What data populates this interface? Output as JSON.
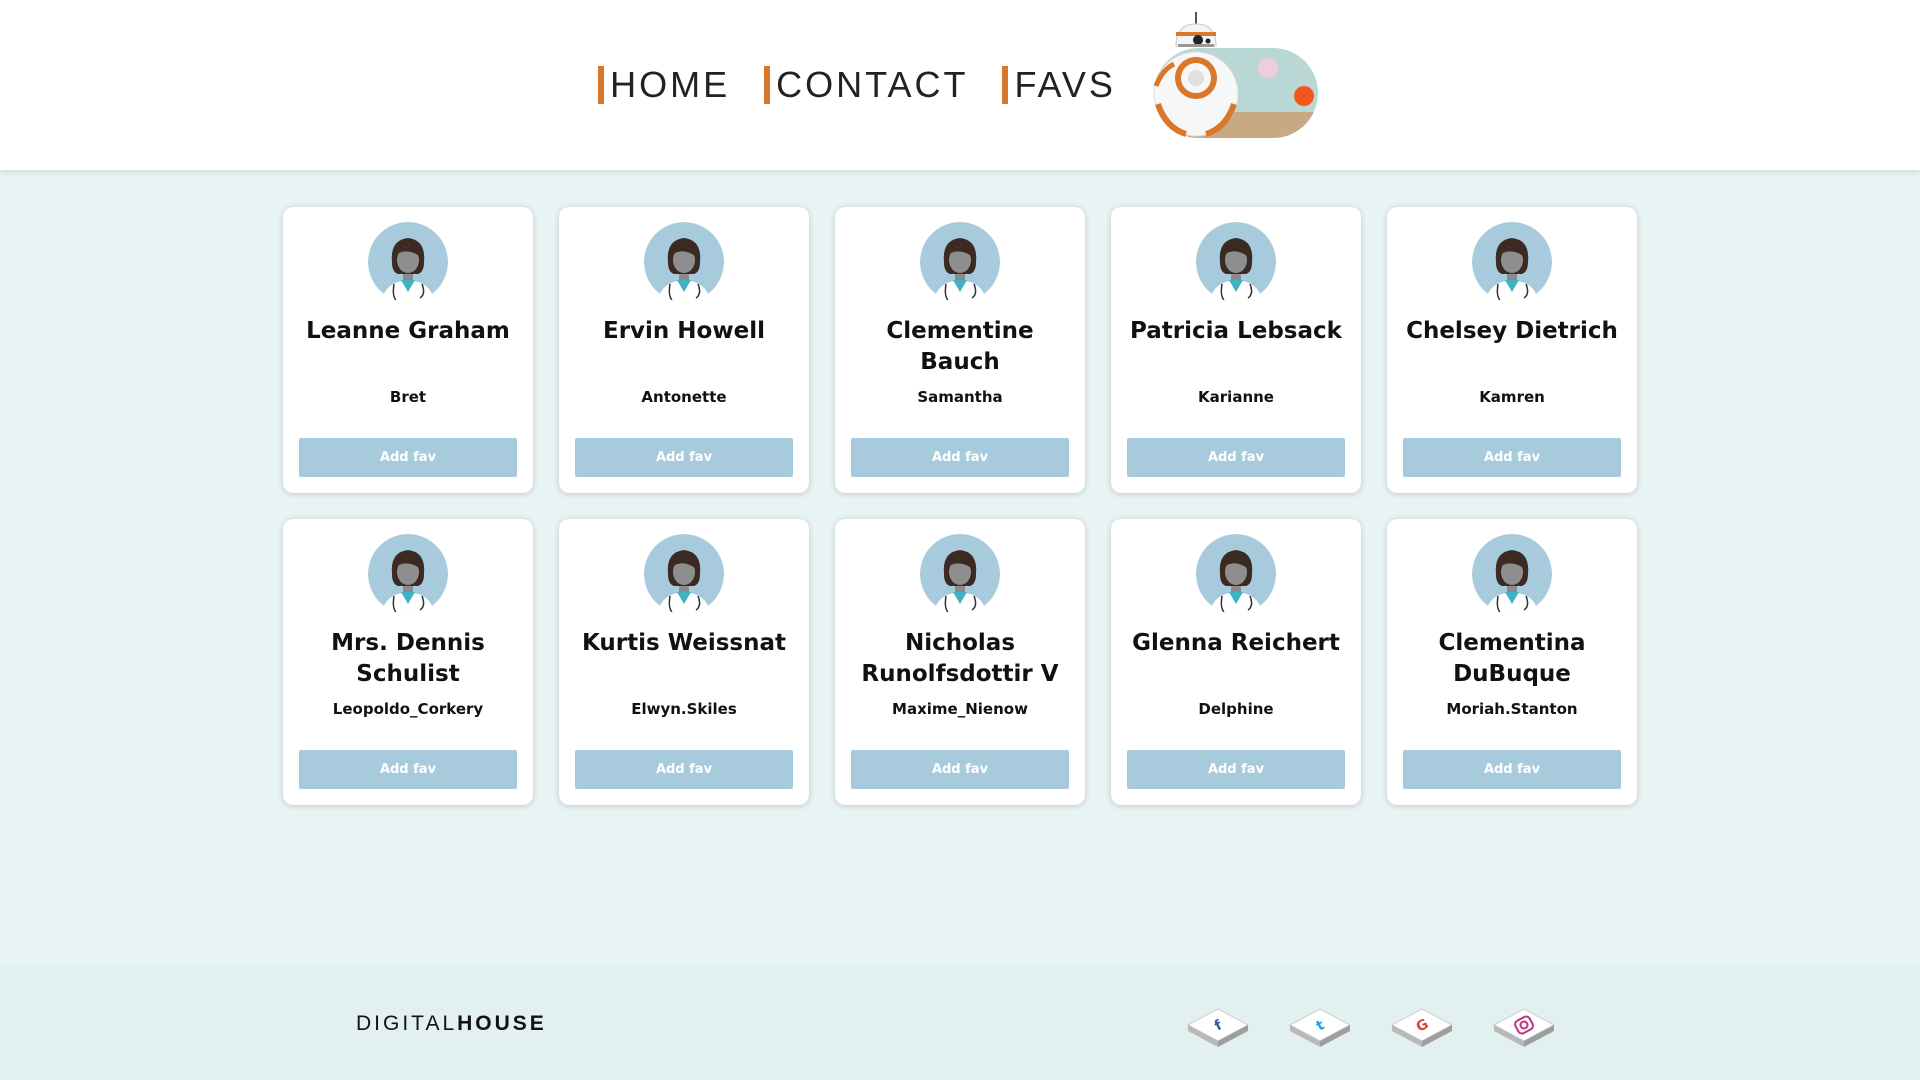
{
  "nav": {
    "links": [
      {
        "label": "HOME"
      },
      {
        "label": "CONTACT"
      },
      {
        "label": "FAVS"
      }
    ],
    "theme_toggle_icon": "bb8-theme-toggle-icon"
  },
  "cards": [
    {
      "name": "Leanne Graham",
      "username": "Bret",
      "button": "Add fav"
    },
    {
      "name": "Ervin Howell",
      "username": "Antonette",
      "button": "Add fav"
    },
    {
      "name": "Clementine Bauch",
      "username": "Samantha",
      "button": "Add fav"
    },
    {
      "name": "Patricia Lebsack",
      "username": "Karianne",
      "button": "Add fav"
    },
    {
      "name": "Chelsey Dietrich",
      "username": "Kamren",
      "button": "Add fav"
    },
    {
      "name": "Mrs. Dennis Schulist",
      "username": "Leopoldo_Corkery",
      "button": "Add fav"
    },
    {
      "name": "Kurtis Weissnat",
      "username": "Elwyn.Skiles",
      "button": "Add fav"
    },
    {
      "name": "Nicholas Runolfsdottir V",
      "username": "Maxime_Nienow",
      "button": "Add fav"
    },
    {
      "name": "Glenna Reichert",
      "username": "Delphine",
      "button": "Add fav"
    },
    {
      "name": "Clementina DuBuque",
      "username": "Moriah.Stanton",
      "button": "Add fav"
    }
  ],
  "footer": {
    "brand_part1": "DIGITAL",
    "brand_part2": "HOUSE",
    "social": [
      {
        "icon": "facebook-icon"
      },
      {
        "icon": "twitter-icon"
      },
      {
        "icon": "google-icon"
      },
      {
        "icon": "instagram-icon"
      }
    ]
  },
  "colors": {
    "accent": "#d9772b",
    "button": "#a8cadd",
    "background": "#e8f3f3",
    "footer_background": "#e2f0f0"
  }
}
